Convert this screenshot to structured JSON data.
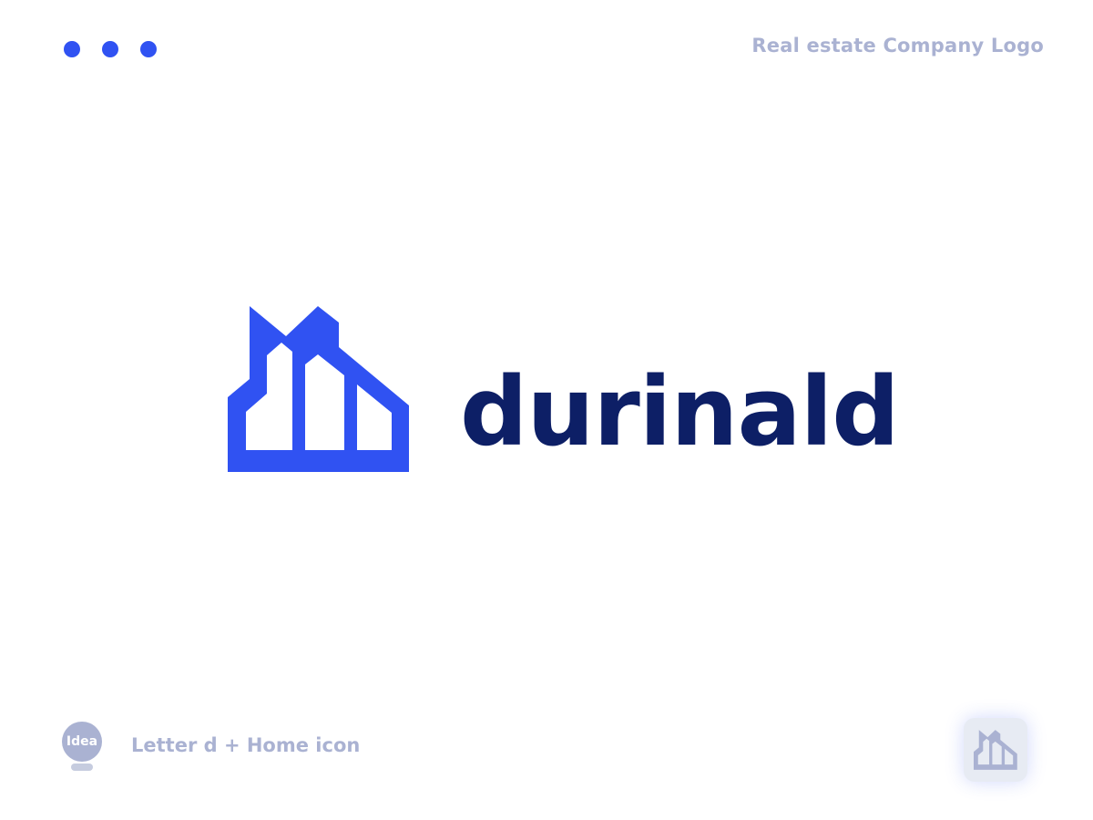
{
  "header": {
    "title": "Real estate Company Logo"
  },
  "logo": {
    "brand_name": "durinald",
    "mark_icon": "building-home-icon",
    "colors": {
      "mark": "#3052f2",
      "wordmark": "#0d1f66",
      "secondary_text": "#aab2d2"
    }
  },
  "footer": {
    "idea_label": "Idea",
    "caption": "Letter d + Home icon"
  }
}
